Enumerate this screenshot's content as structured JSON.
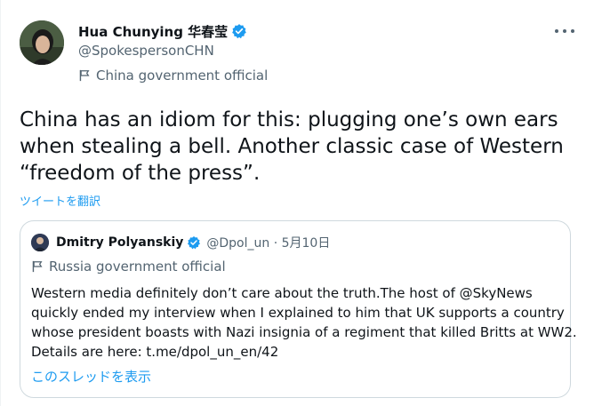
{
  "author": {
    "display_name": "Hua Chunying 华春莹",
    "handle": "@SpokespersonCHN",
    "label": "China government official"
  },
  "tweet": {
    "lines": [
      "China has an idiom for this: plugging one’s own ears",
      "when stealing a bell. Another classic case of Western",
      "“freedom of the press”."
    ],
    "translate_label": "ツイートを翻訳"
  },
  "quote": {
    "display_name": "Dmitry Polyanskiy",
    "handle_date": "@Dpol_un · 5月10日",
    "label": "Russia government official",
    "lines": [
      "Western media definitely don’t care about the truth.The host of @SkyNews",
      "quickly ended my interview when I explained to him that UK supports a country",
      "whose president boasts with Nazi insignia of a regiment that killed Britts at WW2.",
      "Details are here: t.me/dpol_un_en/42"
    ],
    "thread_link": "このスレッドを表示"
  },
  "colors": {
    "verified": "#1d9bf0",
    "link": "#1d9bf0",
    "secondary_text": "#536471"
  },
  "icons": [
    "verified-badge-icon",
    "flag-icon",
    "more-icon"
  ]
}
